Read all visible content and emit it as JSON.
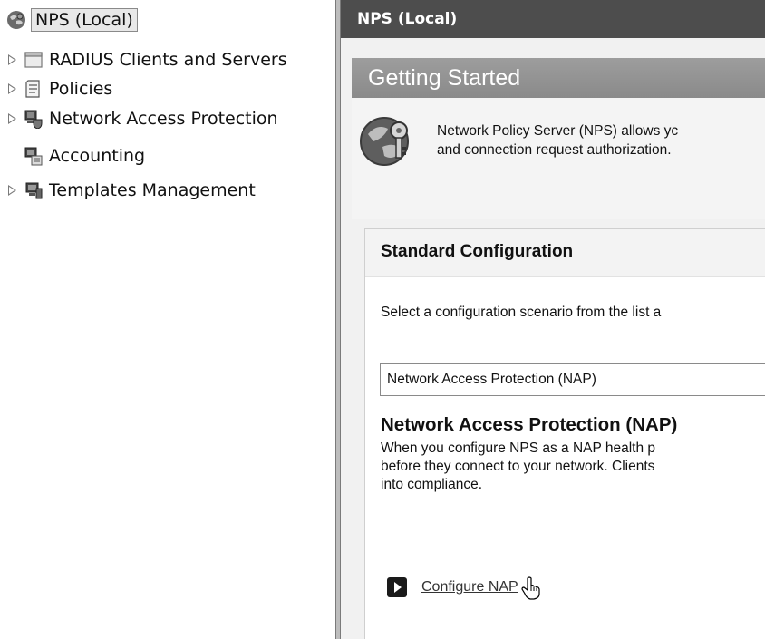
{
  "tree": {
    "root": {
      "label": "NPS (Local)",
      "icon": "nps-globe-icon"
    },
    "items": [
      {
        "label": "RADIUS Clients and Servers",
        "icon": "folder-icon",
        "expandable": true
      },
      {
        "label": "Policies",
        "icon": "policies-icon",
        "expandable": true
      },
      {
        "label": "Network Access Protection",
        "icon": "nap-icon",
        "expandable": true
      },
      {
        "label": "Accounting",
        "icon": "accounting-icon",
        "expandable": false
      },
      {
        "label": "Templates Management",
        "icon": "templates-icon",
        "expandable": true
      }
    ]
  },
  "pane": {
    "header": "NPS (Local)",
    "getting_started": "Getting Started",
    "intro_line1": "Network Policy Server (NPS) allows yc",
    "intro_line2": "and connection request authorization."
  },
  "standard": {
    "title": "Standard Configuration",
    "prompt": "Select a configuration scenario from the list a",
    "scenario_value": "Network Access Protection (NAP)",
    "heading": "Network Access Protection (NAP)",
    "desc_line1": "When you configure NPS as a NAP health p",
    "desc_line2": "before they connect to your network. Clients",
    "desc_line3": "into compliance.",
    "configure_link": "Configure NAP"
  }
}
